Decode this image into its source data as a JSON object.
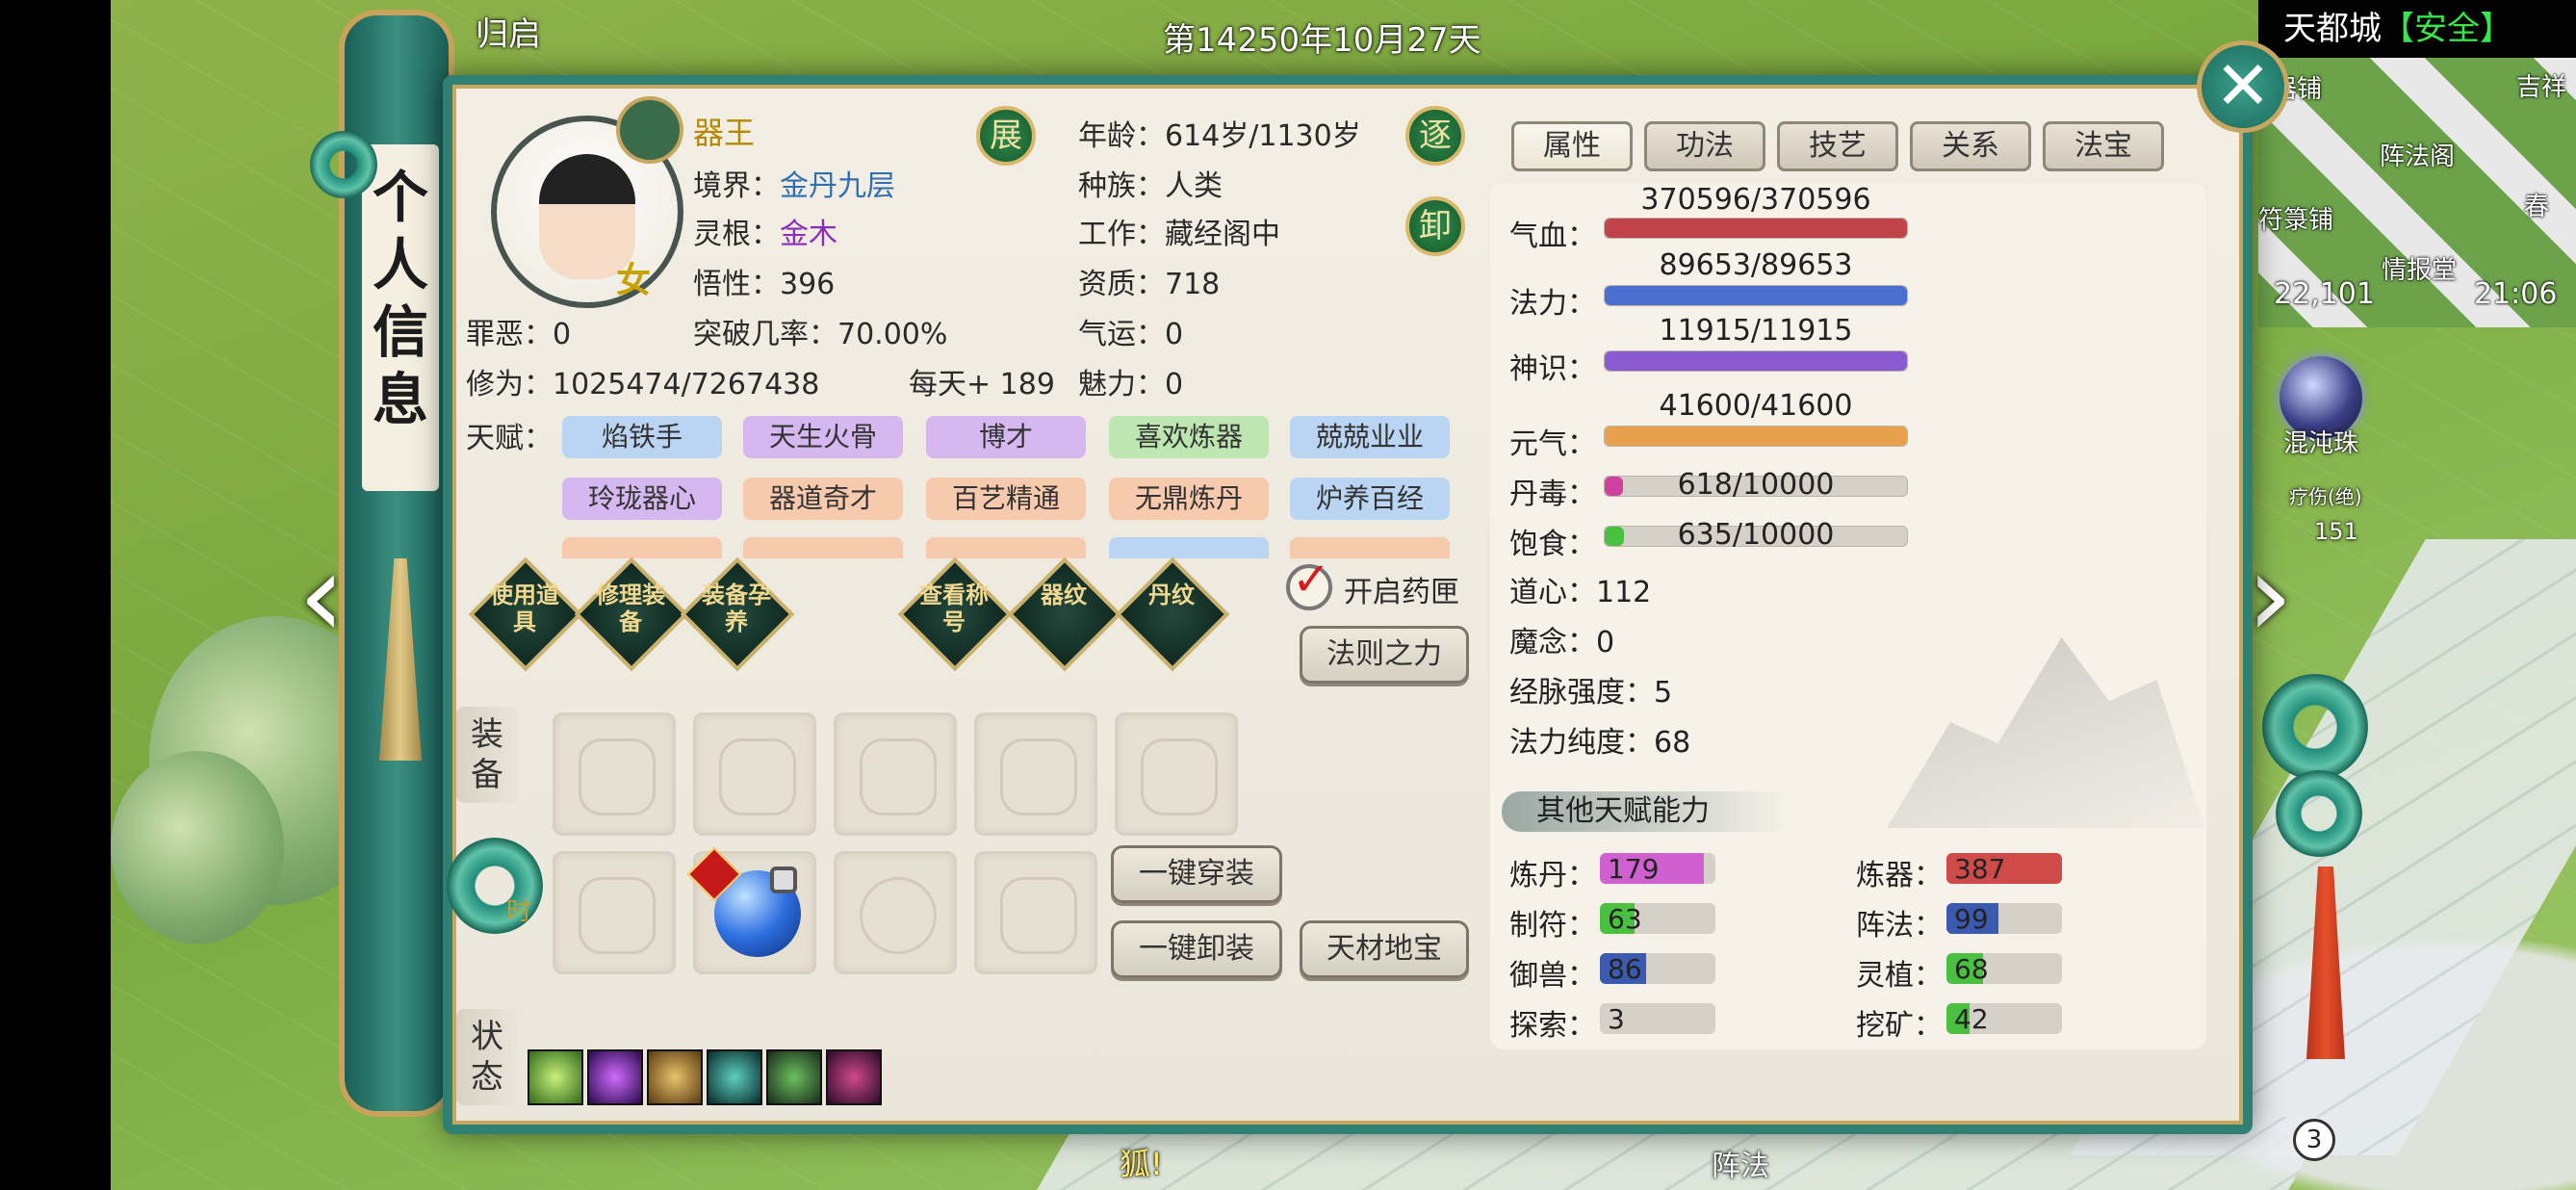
{
  "hud": {
    "date": "第14250年10月27天",
    "return": "归启",
    "fox": "狐!",
    "formation": "阵法",
    "page_number": "3"
  },
  "minimap": {
    "city": "天都城",
    "safety": "【安全】",
    "labels": [
      "器铺",
      "吉祥",
      "阵法阁",
      "符箓铺",
      "春",
      "情报堂"
    ],
    "coord": "22,101",
    "time": "21:06"
  },
  "right_hud": {
    "orb_label": "混沌珠",
    "heal_label": "疗伤(绝)",
    "heal_num": "151"
  },
  "scroll_title": "个人信息",
  "close_icon": "close-icon",
  "character": {
    "name": "器王",
    "gender": "女",
    "realm_label": "境界：",
    "realm": "金丹九层",
    "root_label": "灵根：",
    "root": "金木",
    "comprehension_label": "悟性：",
    "comprehension": "396",
    "sin_label": "罪恶：",
    "sin": "0",
    "breakthrough_label": "突破几率：",
    "breakthrough": "70.00%",
    "cultivation_label": "修为：",
    "cultivation": "1025474/7267438",
    "per_day": "每天+ 189",
    "age_label": "年龄：",
    "age": "614岁/1130岁",
    "race_label": "种族：",
    "race": "人类",
    "job_label": "工作：",
    "job": "藏经阁中",
    "aptitude_label": "资质：",
    "aptitude": "718",
    "luck_label": "气运：",
    "luck": "0",
    "charm_label": "魅力：",
    "charm": "0",
    "btn_expand": "展",
    "btn_expel": "逐",
    "btn_unload": "卸"
  },
  "talents": {
    "label": "天赋：",
    "rows": [
      [
        {
          "text": "焰铁手",
          "color": "blue"
        },
        {
          "text": "天生火骨",
          "color": "purple"
        },
        {
          "text": "博才",
          "color": "purple"
        },
        {
          "text": "喜欢炼器",
          "color": "green"
        },
        {
          "text": "兢兢业业",
          "color": "blue"
        }
      ],
      [
        {
          "text": "玲珑器心",
          "color": "purple"
        },
        {
          "text": "器道奇才",
          "color": "orange"
        },
        {
          "text": "百艺精通",
          "color": "orange"
        },
        {
          "text": "无鼎炼丹",
          "color": "orange"
        },
        {
          "text": "炉养百经",
          "color": "blue"
        }
      ],
      [
        {
          "text": "",
          "color": "orange"
        },
        {
          "text": "",
          "color": "orange"
        },
        {
          "text": "",
          "color": "orange"
        },
        {
          "text": "",
          "color": "blue"
        },
        {
          "text": "",
          "color": "orange"
        }
      ]
    ]
  },
  "actions": [
    {
      "label": "使用道具"
    },
    {
      "label": "修理装备"
    },
    {
      "label": "装备孕养"
    },
    {
      "label": "查看称号"
    },
    {
      "label": "器纹"
    },
    {
      "label": "丹纹"
    }
  ],
  "toggle_medicine": "开启药匣",
  "btn_law": "法则之力",
  "equipment": {
    "label": "装备",
    "fashion_label": "时",
    "equip_all": "一键穿装",
    "unequip_all": "一键卸装",
    "treasure": "天材地宝"
  },
  "status_label": "状态",
  "tabs": [
    "属性",
    "功法",
    "技艺",
    "关系",
    "法宝"
  ],
  "stats": {
    "hp": {
      "label": "气血：",
      "text": "370596/370596",
      "ratio": 1.0,
      "color": "#c0434a"
    },
    "mp": {
      "label": "法力：",
      "text": "89653/89653",
      "ratio": 1.0,
      "color": "#4a6fd0"
    },
    "sense": {
      "label": "神识：",
      "text": "11915/11915",
      "ratio": 1.0,
      "color": "#8a5ad0"
    },
    "vitality": {
      "label": "元气：",
      "text": "41600/41600",
      "ratio": 1.0,
      "color": "#e7a04c"
    },
    "poison": {
      "label": "丹毒：",
      "text": "618/10000",
      "ratio": 0.0618,
      "color": "#d040a0"
    },
    "satiety": {
      "label": "饱食：",
      "text": "635/10000",
      "ratio": 0.0635,
      "color": "#4ac040"
    },
    "dao_heart": "道心：112",
    "demon": "魔念：0",
    "meridian": "经脉强度：5",
    "purity": "法力纯度：68"
  },
  "other_header": "其他天赋能力",
  "abilities": [
    {
      "label": "炼丹：",
      "value": "179",
      "ratio": 0.9,
      "color": "#d060d0"
    },
    {
      "label": "炼器：",
      "value": "387",
      "ratio": 1.0,
      "color": "#d04a4a"
    },
    {
      "label": "制符：",
      "value": "63",
      "ratio": 0.3,
      "color": "#4ac040"
    },
    {
      "label": "阵法：",
      "value": "99",
      "ratio": 0.45,
      "color": "#3a5ab0"
    },
    {
      "label": "御兽：",
      "value": "86",
      "ratio": 0.4,
      "color": "#3a5ab0"
    },
    {
      "label": "灵植：",
      "value": "68",
      "ratio": 0.32,
      "color": "#4ac040"
    },
    {
      "label": "探索：",
      "value": "3",
      "ratio": 0.0,
      "color": "#4ac040"
    },
    {
      "label": "挖矿：",
      "value": "42",
      "ratio": 0.2,
      "color": "#4ac040"
    }
  ]
}
